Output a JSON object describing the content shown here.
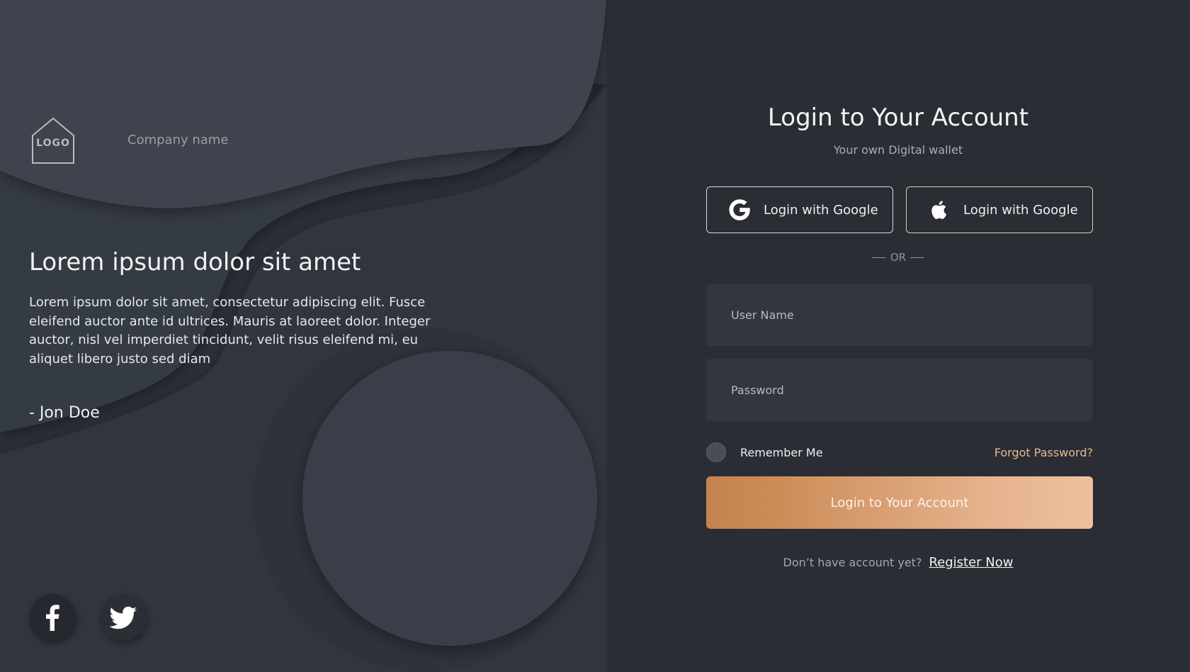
{
  "brand": {
    "logo_text": "LOGO",
    "company_name": "Company name"
  },
  "promo": {
    "headline": "Lorem ipsum dolor sit amet",
    "quote": "Lorem ipsum dolor sit amet, consectetur adipiscing elit. Fusce eleifend auctor ante id ultrices. Mauris at laoreet dolor. Integer auctor, nisl vel imperdiet tincidunt, velit risus eleifend mi, eu aliquet libero justo sed diam",
    "author": "- Jon Doe"
  },
  "social_links": [
    {
      "name": "facebook",
      "icon": "facebook-icon"
    },
    {
      "name": "twitter",
      "icon": "twitter-icon"
    }
  ],
  "login": {
    "title": "Login to Your Account",
    "subtitle": "Your own Digital wallet",
    "google_button_label": "Login with Google",
    "apple_button_label": "Login with Google",
    "divider_text": "OR",
    "username_placeholder": "User Name",
    "password_placeholder": "Password",
    "remember_label": "Remember Me",
    "forgot_label": "Forgot Password?",
    "submit_label": "Login to Your Account",
    "register_prompt": "Don’t have account yet?",
    "register_link": "Register Now"
  },
  "colors": {
    "accent_start": "#c4834f",
    "accent_end": "#edc19e",
    "link_accent": "#e6b894",
    "panel_left": "#2b2f37",
    "panel_right": "#2a2d33"
  }
}
